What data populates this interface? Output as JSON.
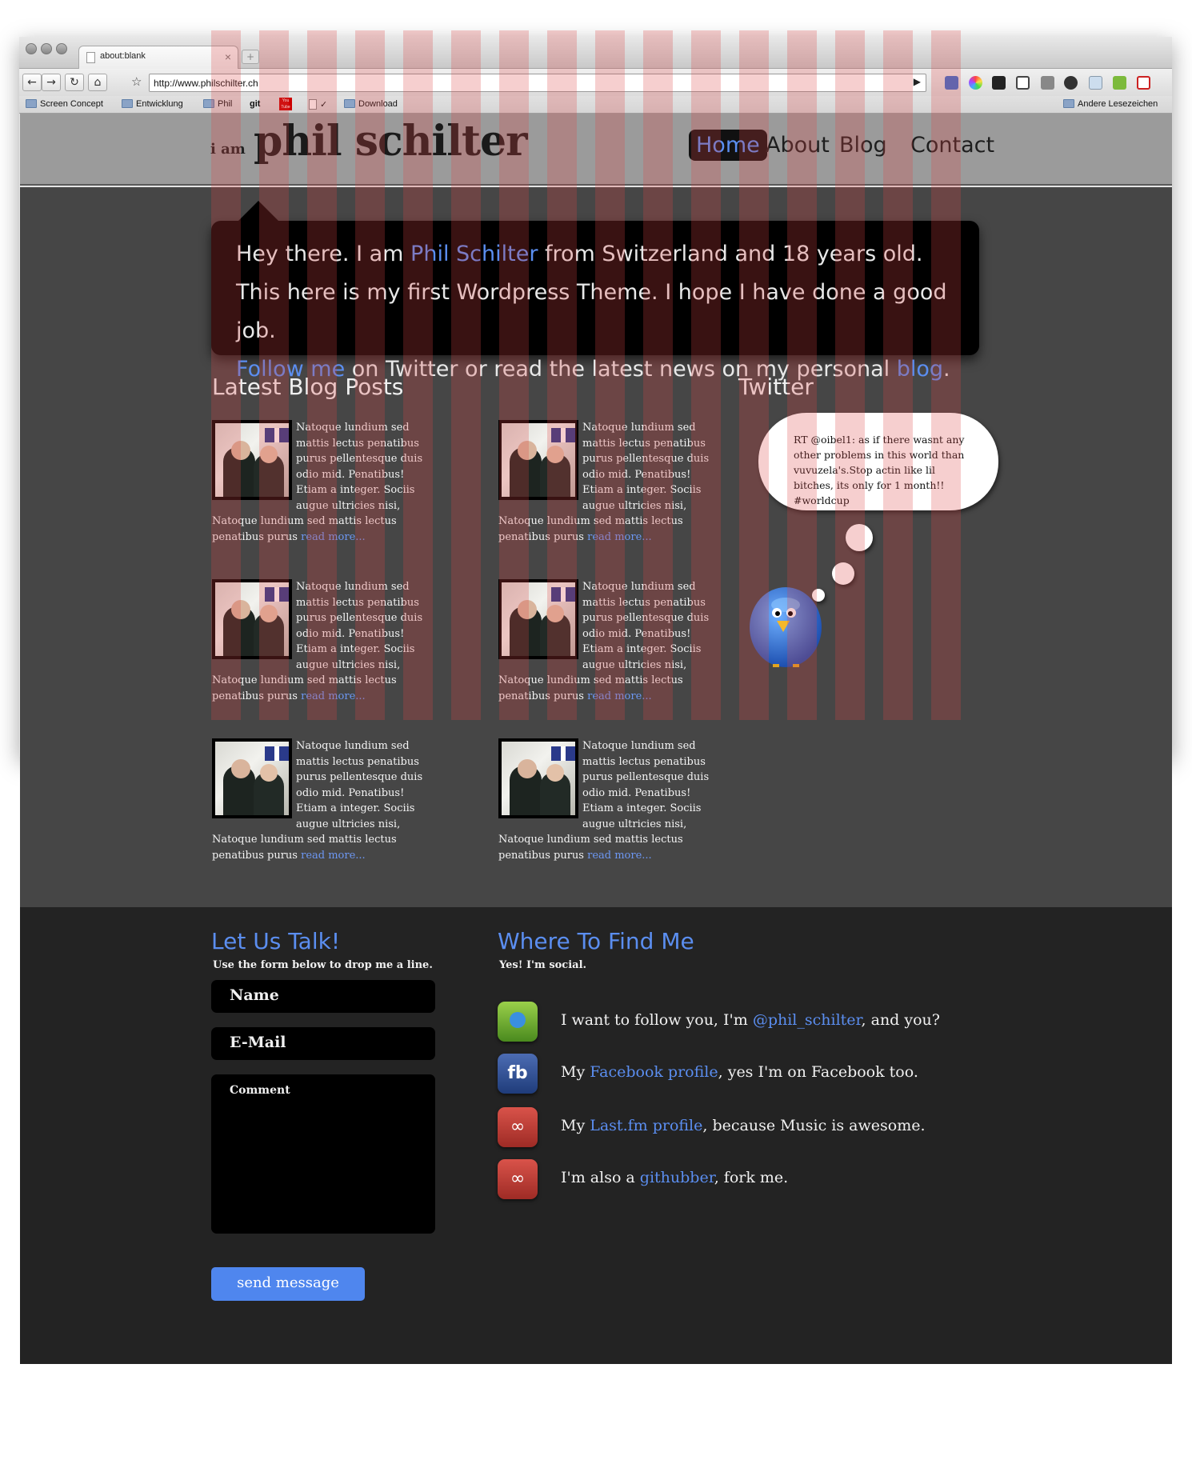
{
  "browser": {
    "tab_title": "about:blank",
    "tab_close": "×",
    "new_tab": "+",
    "url": "http://www.philschilter.ch",
    "nav": {
      "back": "←",
      "forward": "→",
      "reload": "↻",
      "home": "⌂",
      "star": "☆",
      "go": "▶"
    },
    "bookmarks": [
      {
        "label": "Screen Concept",
        "icon": "folder-icon"
      },
      {
        "label": "Entwicklung",
        "icon": "folder-icon"
      },
      {
        "label": "Phil",
        "icon": "folder-icon"
      },
      {
        "label": "git",
        "icon": "none"
      },
      {
        "label": "You Tube",
        "icon": "youtube-icon"
      },
      {
        "label": "✓",
        "icon": "page-icon"
      },
      {
        "label": "Download",
        "icon": "folder-icon"
      }
    ],
    "other_bookmarks": "Andere Lesezeichen",
    "extension_icons": [
      "delicious-icon",
      "color-picker-icon",
      "instapaper-icon",
      "screen-capture-icon",
      "eyedropper-icon",
      "settings-icon",
      "window-icon",
      "evernote-icon",
      "gmail-icon"
    ]
  },
  "site": {
    "brand_prefix": "i am",
    "brand_name": "phil schilter",
    "nav": [
      "Home",
      "About",
      "Blog",
      "Contact"
    ],
    "nav_active": "Home",
    "intro": {
      "l1a": "Hey there. I am ",
      "l1_link": "Phil Schilter",
      "l1b": " from Switzerland and 18 years old.",
      "l2": "This here is my first Wordpress Theme. I hope I have done a good job.",
      "l3_link1": "Follow me",
      "l3a": " on Twitter or read the latest news on my personal ",
      "l3_link2": "blog",
      "l3b": "."
    },
    "blog_heading": "Latest Blog Posts",
    "post": {
      "lines": [
        "Natoque lundium sed",
        "mattis lectus penatibus",
        "purus pellentesque duis",
        "odio mid. Penatibus!",
        "Etiam a integer. Sociis",
        "augue ultricies nisi,",
        "Natoque lundium sed mattis lectus",
        "penatibus purus "
      ],
      "read_more": "read more..."
    },
    "twitter_heading": "Twitter",
    "tweet": "RT @oibel1: as if there wasnt any other problems in this world than vuvuzela's.Stop actin like lil bitches, its only for 1 month!! #worldcup",
    "talk": {
      "heading": "Let Us Talk!",
      "sub": "Use the form below to drop me a line.",
      "name_placeholder": "Name",
      "email_placeholder": "E-Mail",
      "comment_placeholder": "Comment",
      "send": "send message"
    },
    "find": {
      "heading": "Where To Find Me",
      "sub": "Yes! I'm social.",
      "items": [
        {
          "pre": "I want to follow you, I'm ",
          "link": "@phil_schilter",
          "post": ", and you?",
          "icon": "twitter-icon"
        },
        {
          "pre": "My ",
          "link": "Facebook profile",
          "post": ", yes I'm on Facebook too.",
          "icon": "facebook-icon"
        },
        {
          "pre": "My ",
          "link": "Last.fm profile",
          "post": ", because Music is awesome.",
          "icon": "lastfm-icon"
        },
        {
          "pre": "I'm also a ",
          "link": "githubber",
          "post": ", fork me.",
          "icon": "lastfm-icon"
        }
      ],
      "fb_glyph": "fb",
      "lastfm_glyph": "∞"
    }
  },
  "colors": {
    "accent": "#5b8ef0",
    "header": "#9b9b9b",
    "body": "#464646",
    "footer": "#232323",
    "grid": "#dc4646"
  }
}
